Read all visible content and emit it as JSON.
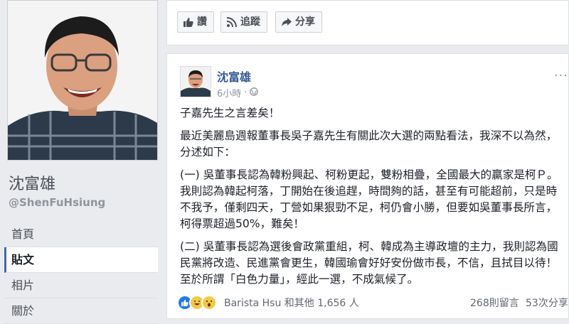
{
  "profile": {
    "name": "沈富雄",
    "handle": "@ShenFuHsiung"
  },
  "nav": [
    {
      "label": "首頁"
    },
    {
      "label": "貼文"
    },
    {
      "label": "相片"
    },
    {
      "label": "關於"
    }
  ],
  "actions": {
    "like_label": "讚",
    "follow_label": "追蹤",
    "share_label": "分享"
  },
  "post": {
    "author": "沈富雄",
    "time": "6小時",
    "paragraphs": [
      "子嘉先生之言差矣！",
      "最近美麗島週報董事長吳子嘉先生有關此次大選的兩點看法，我深不以為然，分述如下：",
      "(一) 吳董事長認為韓粉興起、柯粉更起，雙粉相疊，全國最大的贏家是柯Ｐ。我則認為韓起柯落，丁開始在後追趕，時間夠的話，甚至有可能超前，只是時不我予，僅剩四天，丁營如果狠勁不足，柯仍會小勝，但要如吳董事長所言，柯得票超過50%，難矣！",
      "(二) 吳董事長認為選後會政黨重組，柯、韓成為主導政壇的主力，我則認為國民黨將改造、民進黨會更生，韓國瑜會好好安份做市長，不信，且拭目以待！至於所謂「白色力量」，經此一選，不成氣候了。"
    ],
    "reactions_text": "Barista Hsu 和其他 1,656 人",
    "comments_text": "268則留言",
    "shares_text": "53次分享"
  },
  "colors": {
    "background": "#e9ebee",
    "link": "#365899",
    "like_blue": "#2078f4",
    "emoji_yellow": "#f7c843"
  },
  "icons": [
    "thumbs-up-icon",
    "rss-icon",
    "share-arrow-icon",
    "globe-icon",
    "more-icon"
  ]
}
